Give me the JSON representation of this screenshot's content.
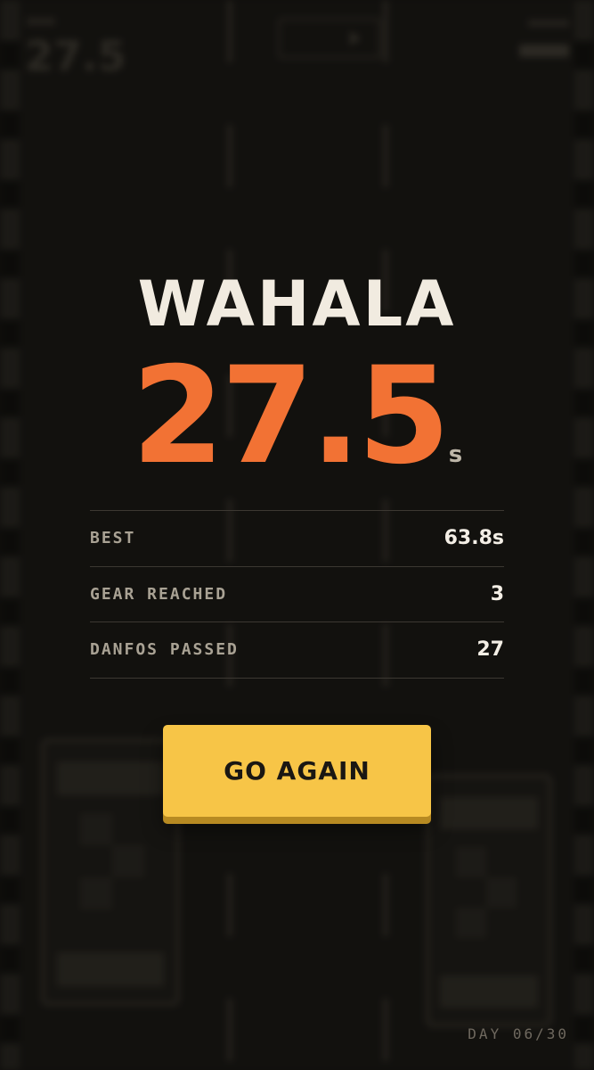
{
  "result": {
    "title": "WAHALA",
    "time_value": "27.5",
    "time_unit": "s"
  },
  "stats": [
    {
      "label": "BEST",
      "value": "63.8s"
    },
    {
      "label": "GEAR REACHED",
      "value": "3"
    },
    {
      "label": "DANFOS PASSED",
      "value": "27"
    }
  ],
  "actions": {
    "go_again_label": "GO AGAIN"
  },
  "progress": {
    "day_label": "DAY 06/30"
  },
  "background_hud": {
    "time": "27.5"
  },
  "colors": {
    "accent_orange": "#f27234",
    "button_yellow": "#f7c547",
    "title_cream": "#f1ebe0",
    "background": "#141210"
  },
  "icons": {
    "play": "play-icon"
  }
}
